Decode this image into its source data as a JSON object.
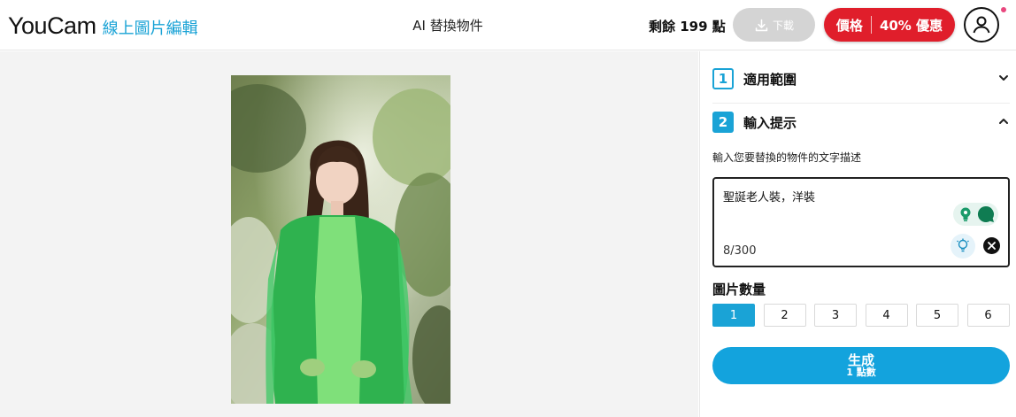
{
  "header": {
    "brand": "YouCam",
    "brand_sub": "線上圖片編輯",
    "tool_title": "AI 替換物件",
    "credits_text": "剩餘 199 點",
    "download_label": "下載",
    "price_label": "價格",
    "promo_label": "40% 優惠",
    "icons": {
      "download": "download-icon",
      "user": "user-icon"
    }
  },
  "panel": {
    "section1": {
      "number": "1",
      "label": "適用範圍",
      "expanded": false
    },
    "section2": {
      "number": "2",
      "label": "輸入提示",
      "expanded": true
    },
    "prompt_instruction": "輸入您要替換的物件的文字描述",
    "prompt_value": "聖誕老人裝，洋裝",
    "char_counter": "8/300",
    "image_count_label": "圖片數量",
    "image_count_options": [
      "1",
      "2",
      "3",
      "4",
      "5",
      "6"
    ],
    "image_count_selected": "1",
    "generate_label": "生成",
    "generate_cost": "1 點數"
  },
  "colors": {
    "accent": "#1aa3d6",
    "promo_red": "#e01e2b",
    "download_disabled": "#d4d4d4",
    "mask_green": "#43d66a"
  }
}
